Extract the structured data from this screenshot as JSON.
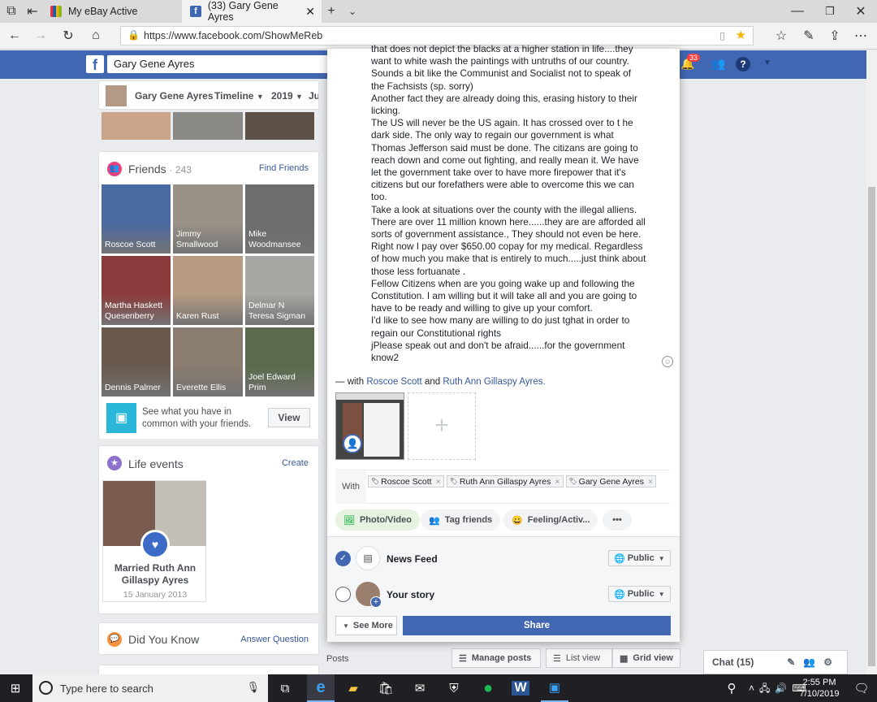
{
  "browser": {
    "tabs": [
      {
        "label": "My eBay Active"
      },
      {
        "label": "(33) Gary Gene Ayres"
      }
    ],
    "url": "https://www.facebook.com/ShowMeReb"
  },
  "fb": {
    "search_value": "Gary Gene Ayres",
    "notif_count": "33",
    "profile_nav": {
      "name": "Gary Gene Ayres",
      "timeline": "Timeline",
      "year": "2019",
      "more": "Ju"
    }
  },
  "friends": {
    "title": "Friends",
    "count": "· 243",
    "find": "Find Friends",
    "people": [
      "Roscoe Scott",
      "Jimmy Smallwood",
      "Mike Woodmansee",
      "Martha Haskett Quesenberry",
      "Karen Rust",
      "Delmar N Teresa Sigman",
      "Dennis Palmer",
      "Everette Ellis",
      "Joel Edward Prim"
    ],
    "common_text": "See what you have in common with your friends.",
    "view": "View"
  },
  "life": {
    "title": "Life events",
    "create": "Create",
    "event": "Married Ruth Ann Gillaspy Ayres",
    "date": "15 January 2013"
  },
  "dyk": {
    "title": "Did You Know",
    "answer": "Answer Question"
  },
  "post": {
    "lines": [
      "that  does not depict the blacks at a higher station in life....they",
      "want to white wash the paintings with untruths  of our country.",
      "Sounds a bit like the Communist and Socialist not to speak of",
      "the Fachsists (sp. sorry)",
      "Another fact they are already doing this, erasing history to their",
      "licking.",
      "The US will never be the US again.  It has crossed over to t he",
      "dark side.  The only way to regain our government is what",
      "Thomas Jefferson said must be done.  The citizans are going to",
      "reach down  and come out fighting, and really mean it. We have",
      "let the government take over to have more firepower that it's",
      "citizens but our forefathers were able to overcome this we can",
      "too.",
      "Take a look at situations over the county with the illegal alliens.",
      "There are over 11 million known here......they are are afforded all",
      "sorts of government assistance.,  They should not even be here.",
      "Right now I pay over $650.00 copay for my medical.  Regardless",
      "of how much you make that is entirely to much.....just think about",
      "those less fortuanate .",
      "Fellow Citizens when are you going wake up and following the",
      "Constitution.  I am willing but it will take all and you are going to",
      "have to be ready and willing to give up your comfort.",
      "I'd like to see how many are willing to do just tghat in order to",
      "regain our Constitutional rights",
      "jPlease speak out and don't be afraid......for the government",
      "know2"
    ],
    "with_prefix": "— with",
    "with_a": "Roscoe Scott",
    "with_and": "and",
    "with_b": "Ruth Ann Gillaspy Ayres.",
    "with_label": "With",
    "tags": [
      "Roscoe Scott",
      "Ruth Ann Gillaspy Ayres",
      "Gary Gene Ayres"
    ],
    "actions": [
      "Photo/Video",
      "Tag friends",
      "Feeling/Activ..."
    ],
    "newsfeed": "News Feed",
    "story": "Your story",
    "public": "Public",
    "see_more": "See More",
    "share": "Share"
  },
  "below": {
    "posts": "Posts",
    "manage": "Manage posts",
    "list": "List view",
    "grid": "Grid view",
    "chat": "Chat (15)"
  },
  "taskbar": {
    "search_placeholder": "Type here to search",
    "time": "2:55 PM",
    "date": "7/10/2019"
  },
  "colors": {
    "fb_blue": "#4267b2",
    "share_btn": "#4267b2",
    "link": "#385898"
  }
}
